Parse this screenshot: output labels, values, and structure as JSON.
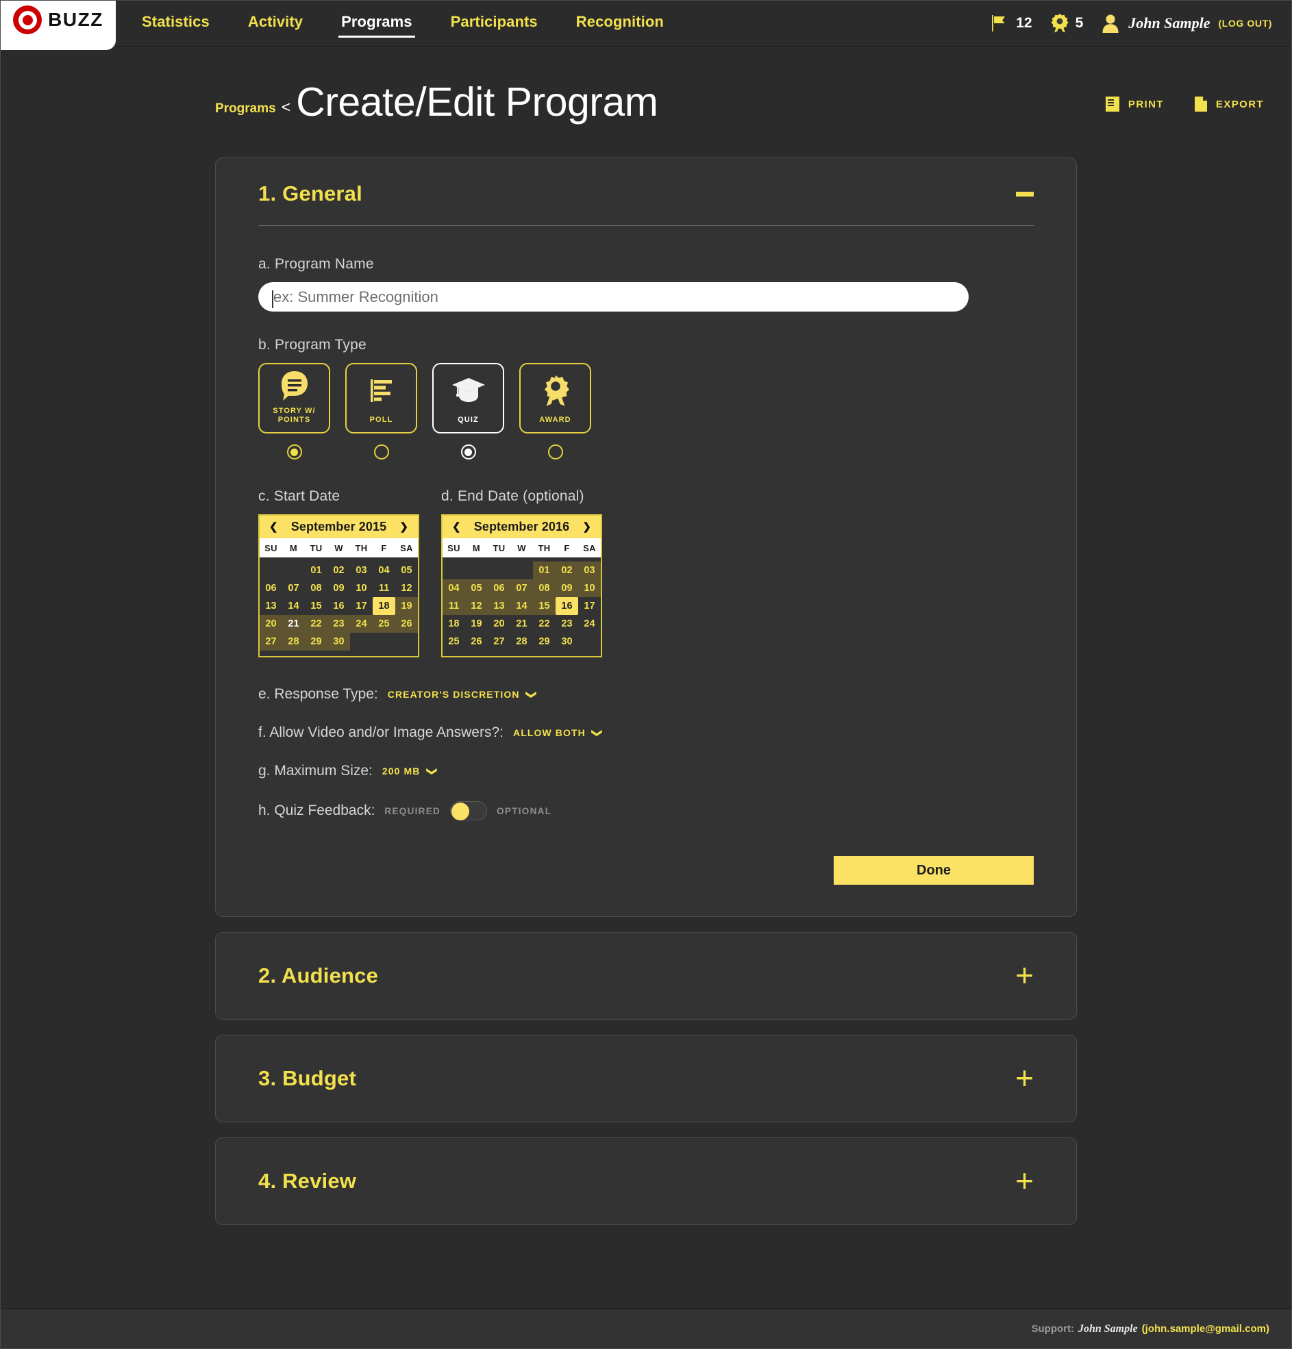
{
  "brand": {
    "logo_word": "BUZZ",
    "logo_icon": "bullseye-icon"
  },
  "nav": {
    "items": [
      {
        "label": "Statistics",
        "active": false
      },
      {
        "label": "Activity",
        "active": false
      },
      {
        "label": "Programs",
        "active": true
      },
      {
        "label": "Participants",
        "active": false
      },
      {
        "label": "Recognition",
        "active": false
      }
    ]
  },
  "header_right": {
    "flag_count": "12",
    "badge_count": "5",
    "user_name": "John Sample",
    "logout_label": "(LOG OUT)"
  },
  "title": {
    "breadcrumb": "Programs",
    "breadcrumb_sep": "<",
    "page_title": "Create/Edit Program",
    "print_label": "PRINT",
    "export_label": "EXPORT"
  },
  "sections": {
    "general": {
      "heading": "1. General",
      "collapse_glyph": "minus-icon",
      "program_name": {
        "label": "a. Program Name",
        "value": "",
        "placeholder": "ex: Summer Recognition"
      },
      "program_type": {
        "label": "b. Program Type",
        "options": [
          {
            "name": "STORY W/ POINTS",
            "icon": "story-bubble-icon",
            "selected_card": false,
            "radio_on": true,
            "radio_style": "yellow"
          },
          {
            "name": "POLL",
            "icon": "bar-chart-icon",
            "selected_card": false,
            "radio_on": false,
            "radio_style": "yellow"
          },
          {
            "name": "QUIZ",
            "icon": "graduation-cap-icon",
            "selected_card": true,
            "radio_on": true,
            "radio_style": "white"
          },
          {
            "name": "AWARD",
            "icon": "award-ribbon-icon",
            "selected_card": false,
            "radio_on": false,
            "radio_style": "yellow"
          }
        ]
      },
      "start_date": {
        "label": "c. Start Date",
        "month": "September 2015",
        "prev_glyph": "❮",
        "next_glyph": "❯",
        "dow": [
          "SU",
          "M",
          "TU",
          "W",
          "TH",
          "F",
          "SA"
        ],
        "lead_blanks": 2,
        "days": [
          {
            "n": "01"
          },
          {
            "n": "02"
          },
          {
            "n": "03"
          },
          {
            "n": "04"
          },
          {
            "n": "05"
          },
          {
            "n": "06"
          },
          {
            "n": "07"
          },
          {
            "n": "08"
          },
          {
            "n": "09"
          },
          {
            "n": "10"
          },
          {
            "n": "11"
          },
          {
            "n": "12"
          },
          {
            "n": "13"
          },
          {
            "n": "14"
          },
          {
            "n": "15"
          },
          {
            "n": "16"
          },
          {
            "n": "17"
          },
          {
            "n": "18",
            "selected": true
          },
          {
            "n": "19",
            "range": true
          },
          {
            "n": "20",
            "range": true
          },
          {
            "n": "21",
            "range": true,
            "today": true
          },
          {
            "n": "22",
            "range": true
          },
          {
            "n": "23",
            "range": true
          },
          {
            "n": "24",
            "range": true
          },
          {
            "n": "25",
            "range": true
          },
          {
            "n": "26",
            "range": true
          },
          {
            "n": "27",
            "range": true
          },
          {
            "n": "28",
            "range": true
          },
          {
            "n": "29",
            "range": true
          },
          {
            "n": "30",
            "range": true
          }
        ]
      },
      "end_date": {
        "label": "d. End Date (optional)",
        "month": "September 2016",
        "prev_glyph": "❮",
        "next_glyph": "❯",
        "dow": [
          "SU",
          "M",
          "TU",
          "W",
          "TH",
          "F",
          "SA"
        ],
        "lead_blanks": 4,
        "days": [
          {
            "n": "01",
            "range": true
          },
          {
            "n": "02",
            "range": true
          },
          {
            "n": "03",
            "range": true
          },
          {
            "n": "04",
            "range": true
          },
          {
            "n": "05",
            "range": true
          },
          {
            "n": "06",
            "range": true
          },
          {
            "n": "07",
            "range": true
          },
          {
            "n": "08",
            "range": true
          },
          {
            "n": "09",
            "range": true
          },
          {
            "n": "10",
            "range": true
          },
          {
            "n": "11",
            "range": true
          },
          {
            "n": "12",
            "range": true
          },
          {
            "n": "13",
            "range": true
          },
          {
            "n": "14",
            "range": true
          },
          {
            "n": "15",
            "range": true
          },
          {
            "n": "16",
            "selected": true
          },
          {
            "n": "17"
          },
          {
            "n": "18"
          },
          {
            "n": "19"
          },
          {
            "n": "20"
          },
          {
            "n": "21"
          },
          {
            "n": "22"
          },
          {
            "n": "23"
          },
          {
            "n": "24"
          },
          {
            "n": "25"
          },
          {
            "n": "26"
          },
          {
            "n": "27"
          },
          {
            "n": "28"
          },
          {
            "n": "29"
          },
          {
            "n": "30"
          }
        ]
      },
      "response_type": {
        "label": "e. Response Type:",
        "value": "CREATOR'S DISCRETION"
      },
      "allow_media": {
        "label": "f. Allow Video and/or Image Answers?:",
        "value": "ALLOW BOTH"
      },
      "maximum_size": {
        "label": "g. Maximum Size:",
        "value": "200 MB"
      },
      "quiz_feedback": {
        "label": "h. Quiz Feedback:",
        "left_label": "REQUIRED",
        "right_label": "OPTIONAL",
        "position": "left"
      },
      "done_label": "Done"
    },
    "audience": {
      "heading": "2. Audience",
      "expand_glyph": "plus-icon"
    },
    "budget": {
      "heading": "3. Budget",
      "expand_glyph": "plus-icon"
    },
    "review": {
      "heading": "4. Review",
      "expand_glyph": "plus-icon"
    }
  },
  "footer": {
    "support_label": "Support:",
    "support_name": "John Sample",
    "support_email": "(john.sample@gmail.com)"
  },
  "colors": {
    "accent_yellow": "#f2e14c",
    "bright_yellow": "#fbe265",
    "panel_bg": "#333333",
    "page_bg": "#2b2b2b",
    "range_olive": "#5e5530",
    "logo_red": "#cc0000"
  }
}
